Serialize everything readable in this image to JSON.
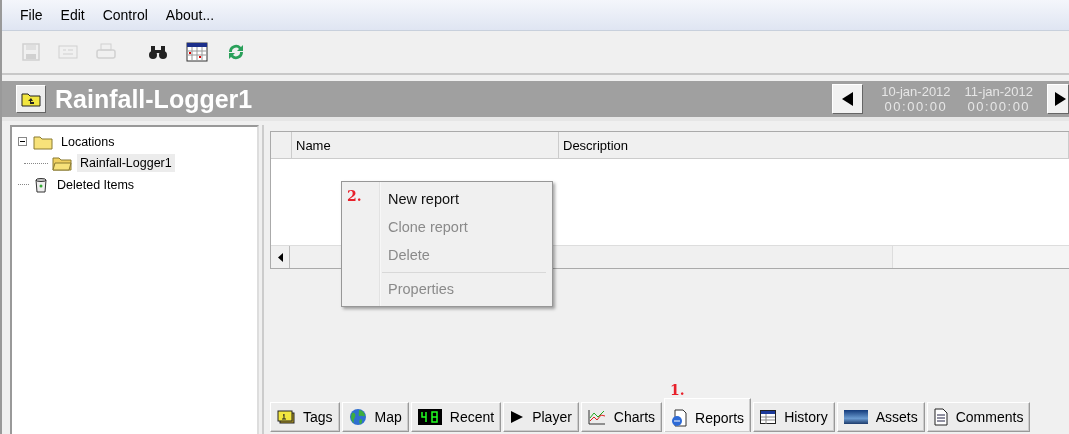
{
  "menu_bar": [
    "File",
    "Edit",
    "Control",
    "About..."
  ],
  "toolbar": [
    {
      "kind": "save",
      "disabled": true
    },
    {
      "kind": "card",
      "disabled": true
    },
    {
      "kind": "print",
      "disabled": true
    },
    {
      "kind": "find",
      "disabled": false
    },
    {
      "kind": "calendar",
      "disabled": false
    },
    {
      "kind": "refresh",
      "disabled": false
    }
  ],
  "title_bar": {
    "title": "Rainfall-Logger1",
    "range_start": {
      "date": "10-jan-2012",
      "time": "00:00:00"
    },
    "range_end": {
      "date": "11-jan-2012",
      "time": "00:00:00"
    }
  },
  "tree": [
    {
      "label": "Locations",
      "kind": "folder",
      "expanded": true,
      "selected": false,
      "children": [
        {
          "label": "Rainfall-Logger1",
          "kind": "open-folder",
          "selected": true
        }
      ]
    },
    {
      "label": "Deleted Items",
      "kind": "bin",
      "selected": false
    }
  ],
  "table": {
    "columns": [
      "Name",
      "Description"
    ]
  },
  "context_menu": {
    "annotation": "2.",
    "items": [
      {
        "label": "New report",
        "disabled": false,
        "separator_before": false
      },
      {
        "label": "Clone report",
        "disabled": true,
        "separator_before": false
      },
      {
        "label": "Delete",
        "disabled": true,
        "separator_before": false
      },
      {
        "label": "Properties",
        "disabled": true,
        "separator_before": true
      }
    ]
  },
  "tabs": [
    {
      "label": "Tags",
      "kind": "tags",
      "selected": false
    },
    {
      "label": "Map",
      "kind": "globe",
      "selected": false
    },
    {
      "label": "Recent",
      "kind": "display",
      "selected": false
    },
    {
      "label": "Player",
      "kind": "play",
      "selected": false
    },
    {
      "label": "Charts",
      "kind": "chart",
      "selected": false
    },
    {
      "label": "Reports",
      "kind": "report",
      "selected": true,
      "annotation": "1."
    },
    {
      "label": "History",
      "kind": "table",
      "selected": false
    },
    {
      "label": "Assets",
      "kind": "picture",
      "selected": false
    },
    {
      "label": "Comments",
      "kind": "document",
      "selected": false
    }
  ]
}
